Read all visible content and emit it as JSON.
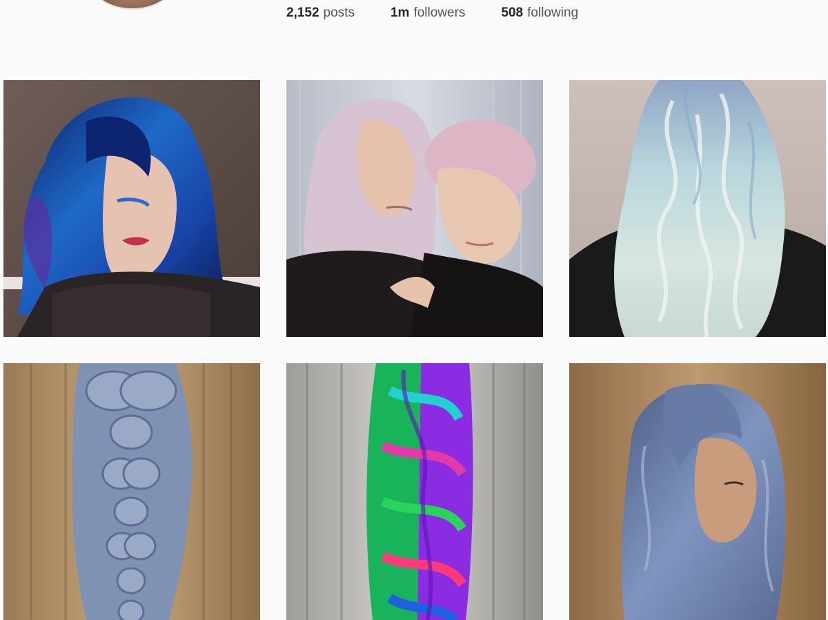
{
  "profile": {
    "stats": [
      {
        "value": "2,152",
        "label": "posts"
      },
      {
        "value": "1m",
        "label": "followers"
      },
      {
        "value": "508",
        "label": "following"
      }
    ]
  },
  "grid": {
    "tiles": [
      {
        "subject": "blue-hair-portrait"
      },
      {
        "subject": "pastel-pink-hair-duo"
      },
      {
        "subject": "icy-pastel-waves"
      },
      {
        "subject": "lavender-braid-back"
      },
      {
        "subject": "rainbow-braid"
      },
      {
        "subject": "slate-blue-waves"
      }
    ]
  }
}
